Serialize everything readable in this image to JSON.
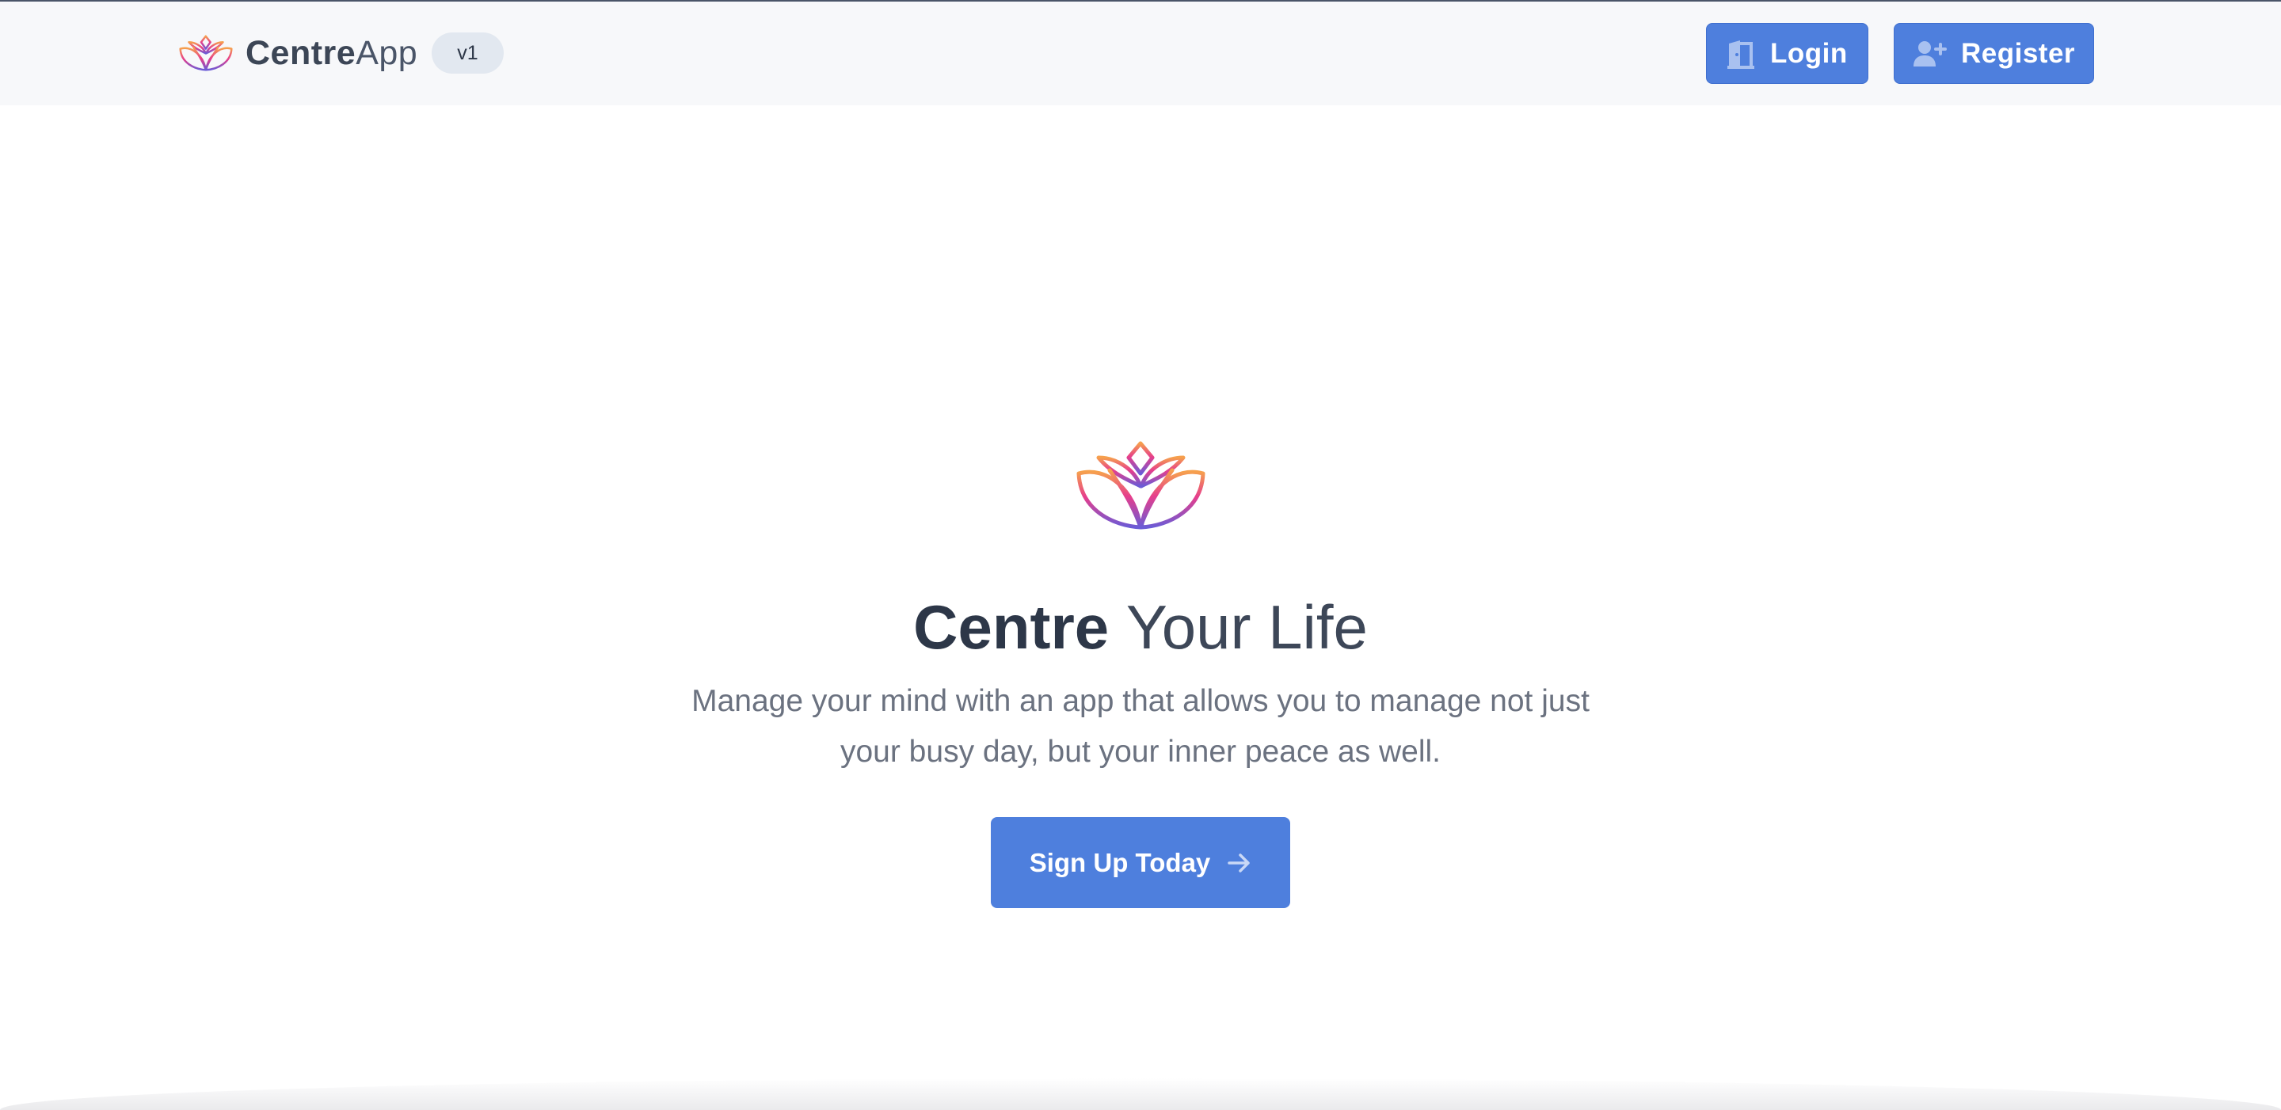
{
  "header": {
    "brand_bold": "Centre",
    "brand_light": "App",
    "version": "v1",
    "logo_icon": "lotus-icon",
    "login_label": "Login",
    "login_icon": "door-icon",
    "register_label": "Register",
    "register_icon": "user-plus-icon"
  },
  "hero": {
    "logo_icon": "lotus-icon",
    "title_bold": "Centre",
    "title_light": "Your Life",
    "subtitle": "Manage your mind with an app that allows you to manage not just your busy day, but your inner peace as well.",
    "cta_label": "Sign Up Today",
    "cta_icon": "arrow-right-icon"
  },
  "colors": {
    "accent": "#4e7fdd",
    "header_bg": "#f7f8fa",
    "text_dark": "#2d3748",
    "text_muted": "#6b7280",
    "lotus_top": "#f6a04d",
    "lotus_mid": "#e63e8c",
    "lotus_bottom": "#6b5bd6"
  }
}
